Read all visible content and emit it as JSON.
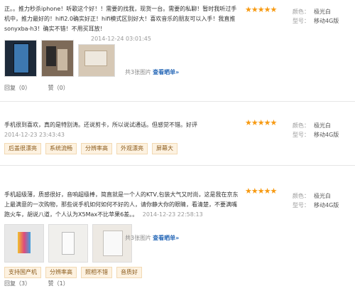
{
  "reviews": [
    {
      "content": "正。。推力秒杀iphone！听歌这个好！！需要的找我，现货一台。需要的私聊！暂时我听过手机中，推力最好的！hifi2.0确实好正！hifi模式区别好大！喜欢音乐的朋友可以入手！我直推sonyxba-h3！确实不错！不用买耳放！",
      "time": "2014-12-24 03:01:45",
      "rating": 5,
      "color_label": "颜色：",
      "color_value": "极光白",
      "model_label": "型号：",
      "model_value": "移动4G版",
      "image_count_text": "共3张图片",
      "view_link": "查看晒单»",
      "reply": "回复（0）",
      "like": "赞（0）",
      "tags": []
    },
    {
      "content": "手机很到喜欢，真的是特别涛。还说剪卡，所以说试通话。但感觉不错。好评",
      "time": "2014-12-23 23:43:43",
      "rating": 5,
      "color_label": "颜色：",
      "color_value": "极光白",
      "model_label": "型号：",
      "model_value": "移动4G版",
      "tags": [
        "后盖很漂亮",
        "系统流畅",
        "分辨率高",
        "外观漂亮",
        "屏幕大"
      ]
    },
    {
      "content": "手机超级薄，质感很好，音响超级棒，简直就是一个人的KTV,包装大气又时尚，这是我在京东上最满意的一次购物，那些说手机如何如何不好的人，请你静大你的眼睛，看清楚，不要满嘴跑火车，胡说八道，个人认为X5Max不比苹果6差。。",
      "time": "2014-12-23 22:58:13",
      "rating": 5,
      "color_label": "颜色：",
      "color_value": "极光白",
      "model_label": "型号：",
      "model_value": "移动4G版",
      "image_count_text": "共3张图片",
      "view_link": "查看晒单»",
      "tags": [
        "支持国产机",
        "分辨率高",
        "照相不错",
        "音质好"
      ],
      "reply": "回复（3）",
      "like": "赞（1）"
    }
  ]
}
